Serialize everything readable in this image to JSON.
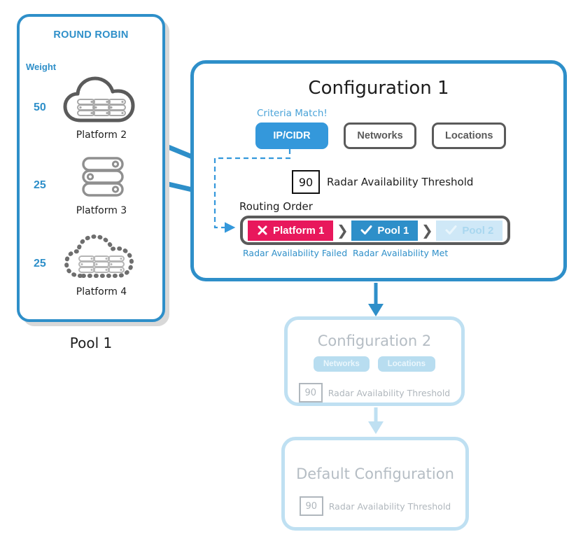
{
  "colors": {
    "brand_blue": "#2e8fc9",
    "accent_blue": "#3498db",
    "fail_pink": "#e8185c",
    "muted_blue": "#cfe8f7",
    "faded_border": "#bfe0f2",
    "faded_text": "#b5bdc4",
    "gray_outline": "#5a5a5a",
    "shadow_gray": "#d8d8d8"
  },
  "pool_panel": {
    "title": "ROUND ROBIN",
    "weight_header": "Weight",
    "caption": "Pool 1",
    "members": [
      {
        "weight": "50",
        "name": "Platform 2",
        "icon": "cloud-servers-icon"
      },
      {
        "weight": "25",
        "name": "Platform 3",
        "icon": "server-stack-icon"
      },
      {
        "weight": "25",
        "name": "Platform 4",
        "icon": "dashed-cloud-servers-icon"
      }
    ]
  },
  "config1": {
    "title": "Configuration 1",
    "criteria_match_label": "Criteria Match!",
    "criteria": [
      {
        "label": "IP/CIDR",
        "state": "active"
      },
      {
        "label": "Networks",
        "state": "inactive"
      },
      {
        "label": "Locations",
        "state": "inactive"
      }
    ],
    "threshold_value": "90",
    "threshold_label": "Radar Availability Threshold",
    "routing_label": "Routing Order",
    "routing_chips": [
      {
        "label": "Platform 1",
        "icon": "x-mark-icon",
        "state": "failed"
      },
      {
        "label": "Pool 1",
        "icon": "check-mark-icon",
        "state": "selected"
      },
      {
        "label": "Pool 2",
        "icon": "check-mark-icon",
        "state": "muted"
      }
    ],
    "chevron": "❯",
    "status_failed": "Radar Availability Failed",
    "status_met": "Radar Availability Met"
  },
  "config2": {
    "title": "Configuration 2",
    "criteria": [
      "Networks",
      "Locations"
    ],
    "threshold_value": "90",
    "threshold_label": "Radar Availability Threshold"
  },
  "default_config": {
    "title": "Default Configuration",
    "threshold_value": "90",
    "threshold_label": "Radar Availability Threshold"
  }
}
